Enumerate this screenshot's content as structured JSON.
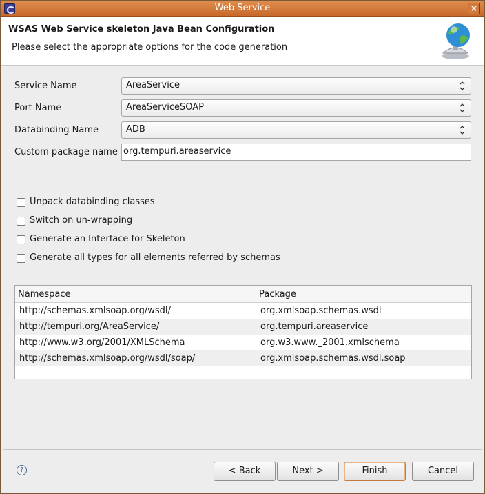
{
  "window": {
    "title": "Web Service"
  },
  "banner": {
    "heading": "WSAS Web Service skeleton Java Bean Configuration",
    "description": "Please select the appropriate options for the code generation"
  },
  "form": {
    "service_name": {
      "label": "Service Name",
      "value": "AreaService"
    },
    "port_name": {
      "label": "Port Name",
      "value": "AreaServiceSOAP"
    },
    "databinding_name": {
      "label": "Databinding Name",
      "value": "ADB"
    },
    "custom_package": {
      "label": "Custom package name",
      "value": "org.tempuri.areaservice"
    }
  },
  "options": [
    {
      "label": "Unpack databinding classes",
      "checked": false
    },
    {
      "label": "Switch on un-wrapping",
      "checked": false
    },
    {
      "label": "Generate an Interface for Skeleton",
      "checked": false
    },
    {
      "label": "Generate all types for all elements referred by schemas",
      "checked": false
    }
  ],
  "mapping_table": {
    "columns": [
      "Namespace",
      "Package"
    ],
    "rows": [
      [
        "http://schemas.xmlsoap.org/wsdl/",
        "org.xmlsoap.schemas.wsdl"
      ],
      [
        "http://tempuri.org/AreaService/",
        "org.tempuri.areaservice"
      ],
      [
        "http://www.w3.org/2001/XMLSchema",
        "org.w3.www._2001.xmlschema"
      ],
      [
        "http://schemas.xmlsoap.org/wsdl/soap/",
        "org.xmlsoap.schemas.wsdl.soap"
      ]
    ]
  },
  "buttons": {
    "help": "?",
    "back": "< Back",
    "next": "Next >",
    "finish": "Finish",
    "cancel": "Cancel"
  },
  "icons": {
    "app": "eclipse-icon",
    "close": "close-icon",
    "banner": "globe-service-icon",
    "help": "help-icon"
  }
}
